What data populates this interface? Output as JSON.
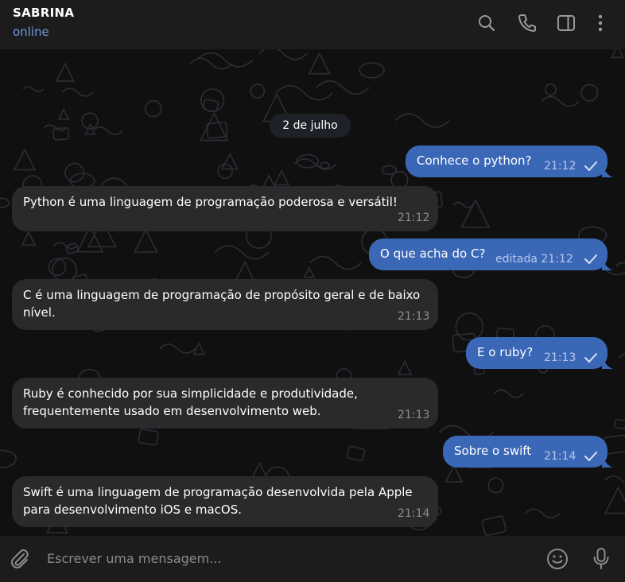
{
  "header": {
    "contact_name": "SABRINA",
    "status": "online",
    "icons": [
      "search-icon",
      "phone-icon",
      "sidebar-toggle-icon",
      "more-vertical-icon"
    ]
  },
  "date_separator": "2 de julho",
  "messages": [
    {
      "direction": "out",
      "text": "Conhece o python?",
      "time": "21:12",
      "read": true
    },
    {
      "direction": "in",
      "text": "Python é uma linguagem de programação poderosa e versátil!",
      "time": "21:12"
    },
    {
      "direction": "out",
      "text": "O que acha do C?",
      "time": "editada 21:12",
      "read": true
    },
    {
      "direction": "in",
      "lines": [
        "C é uma linguagem de programação de propósito geral e de baixo",
        "nível."
      ],
      "time": "21:13"
    },
    {
      "direction": "out",
      "text": "E o ruby?",
      "time": "21:13",
      "read": true
    },
    {
      "direction": "in",
      "lines": [
        "Ruby é conhecido por sua simplicidade e produtividade,",
        "frequentemente usado em desenvolvimento web."
      ],
      "time": "21:13"
    },
    {
      "direction": "out",
      "text": "Sobre o swift",
      "time": "21:14",
      "read": true
    },
    {
      "direction": "in",
      "lines": [
        "Swift é uma linguagem de programação desenvolvida pela Apple",
        "para desenvolvimento iOS e macOS."
      ],
      "time": "21:14"
    }
  ],
  "composer": {
    "placeholder": "Escrever uma mensagem...",
    "icons": [
      "attach-icon",
      "emoji-icon",
      "microphone-icon"
    ]
  },
  "colors": {
    "outgoing_bubble": "#3a67b6",
    "incoming_bubble": "#2a2a2c",
    "status_accent": "#6c9be0",
    "header_bg": "#1c1c1d"
  }
}
